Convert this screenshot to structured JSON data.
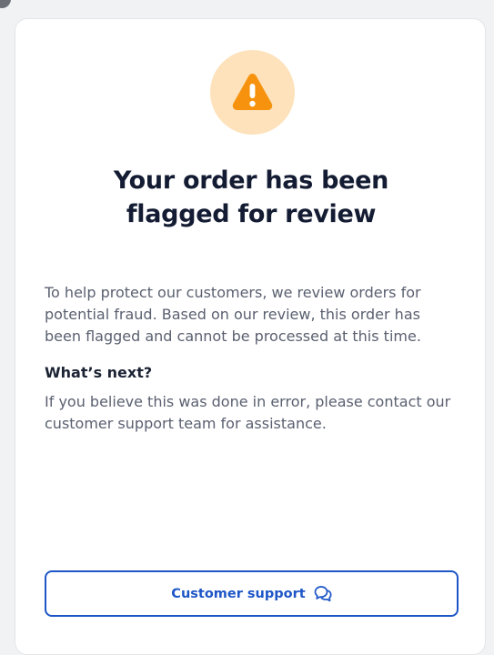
{
  "header": {
    "title_lines": [
      "Your order has been",
      "flagged for review"
    ]
  },
  "icons": {
    "status_icon": "warning-triangle-icon",
    "button_icon": "chat-bubbles-icon"
  },
  "content": {
    "intro_lines": [
      "To help protect our customers, we review orders for",
      "potential fraud. Based on our review, this order has",
      "been flagged and cannot be processed at this time."
    ],
    "next_heading": "What’s next?",
    "next_lines": [
      "If you believe this was done in error, please contact our",
      "customer support team for assistance."
    ]
  },
  "actions": {
    "support_label": "Customer support"
  },
  "colors": {
    "warning_bg": "#fde2bb",
    "warning_fg": "#f7920f",
    "accent": "#1e56c7",
    "title": "#141c33",
    "body": "#5a6070"
  }
}
